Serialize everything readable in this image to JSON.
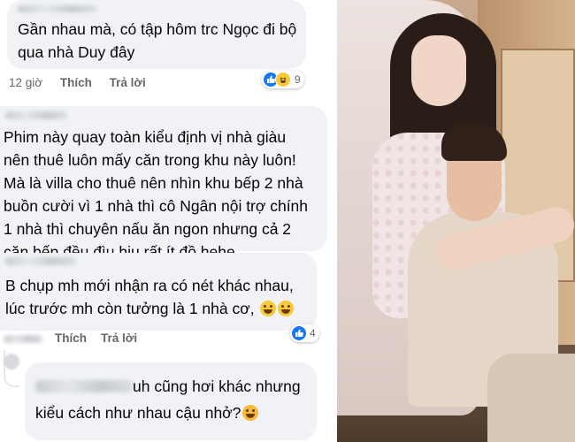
{
  "comments": [
    {
      "text": "Gần nhau mà, có tập hôm trc Ngọc đi bộ\nqua nhà Duy đây",
      "time": "12 giờ",
      "like_label": "Thích",
      "reply_label": "Trả lời",
      "reaction_count": "9"
    },
    {
      "text": "Phim này quay toàn kiểu định vị nhà giàu\nnên thuê luôn mấy căn trong khu này luôn!\nMà là villa cho thuê nên nhìn khu bếp 2 nhà\nbuồn cười vì 1 nhà thì cô Ngân nội trợ chính\n1 nhà thì chuyên nấu ăn ngon nhưng cả 2\ncăn bếp đều đìu hiu rất ít đồ hehe"
    },
    {
      "text": "B chụp mh mới nhận ra có nét khác nhau,\nlúc trước mh còn tưởng là 1 nhà cơ,",
      "time": "",
      "like_label": "Thích",
      "reply_label": "Trả lời",
      "reaction_count": "4"
    },
    {
      "text_line1": "uh cũng hơi khác nhưng",
      "text_line2": "kiểu cách như nhau cậu nhở?"
    }
  ],
  "colors": {
    "bubble": "#f0f2f5",
    "like_blue": "#1877f2",
    "meta_gray": "#65676b"
  },
  "icons": [
    "like-icon",
    "haha-icon",
    "laughing-emoji",
    "smiling-hearts-emoji",
    "blurred-name",
    "avatar"
  ]
}
